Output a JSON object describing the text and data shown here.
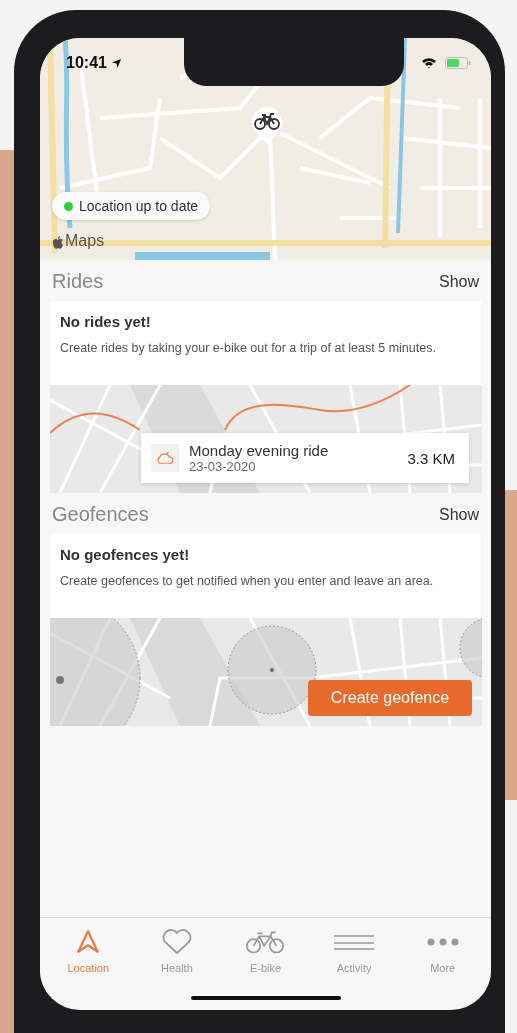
{
  "status_bar": {
    "time": "10:41"
  },
  "map": {
    "attribution": "Maps",
    "location_status": {
      "label": "Location up to date",
      "color": "#2ecc40"
    }
  },
  "rides": {
    "title": "Rides",
    "action": "Show",
    "empty_title": "No rides yet!",
    "empty_text": "Create rides by taking your e-bike out for a trip of at least 5 minutes.",
    "sample_ride": {
      "name": "Monday evening ride",
      "date": "23-03-2020",
      "distance": "3.3 KM"
    }
  },
  "geofences": {
    "title": "Geofences",
    "action": "Show",
    "empty_title": "No geofences yet!",
    "empty_text": "Create geofences to get notified when you enter and leave an area.",
    "button": "Create geofence"
  },
  "tabs": [
    {
      "label": "Location",
      "selected": true
    },
    {
      "label": "Health",
      "selected": false
    },
    {
      "label": "E-bike",
      "selected": false
    },
    {
      "label": "Activity",
      "selected": false
    },
    {
      "label": "More",
      "selected": false
    }
  ]
}
